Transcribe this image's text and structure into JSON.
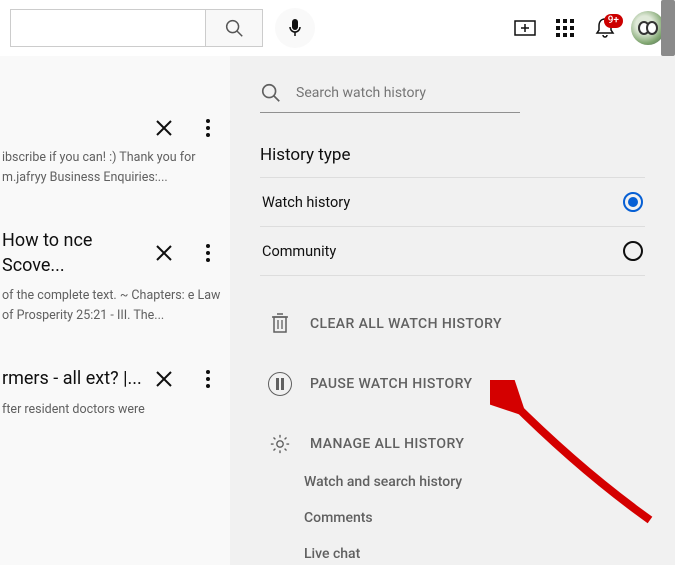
{
  "header": {
    "search_value": "",
    "notification_badge": "9+"
  },
  "sidebar_search": {
    "placeholder": "Search watch history"
  },
  "history_type": {
    "title": "History type",
    "options": [
      {
        "label": "Watch history",
        "selected": true
      },
      {
        "label": "Community",
        "selected": false
      }
    ]
  },
  "actions": {
    "clear": "CLEAR ALL WATCH HISTORY",
    "pause": "PAUSE WATCH HISTORY",
    "manage": "MANAGE ALL HISTORY"
  },
  "sub_actions": [
    "Watch and search history",
    "Comments",
    "Live chat"
  ],
  "videos": [
    {
      "title": "",
      "desc": "ibscribe if you can! :) Thank you for m.jafryy Business Enquiries:..."
    },
    {
      "title": "How to nce Scove...",
      "desc": "of the complete text. ~ Chapters: e Law of Prosperity 25:21 - III. The..."
    },
    {
      "title": "rmers - all ext? |...",
      "desc": "fter resident doctors were"
    }
  ]
}
